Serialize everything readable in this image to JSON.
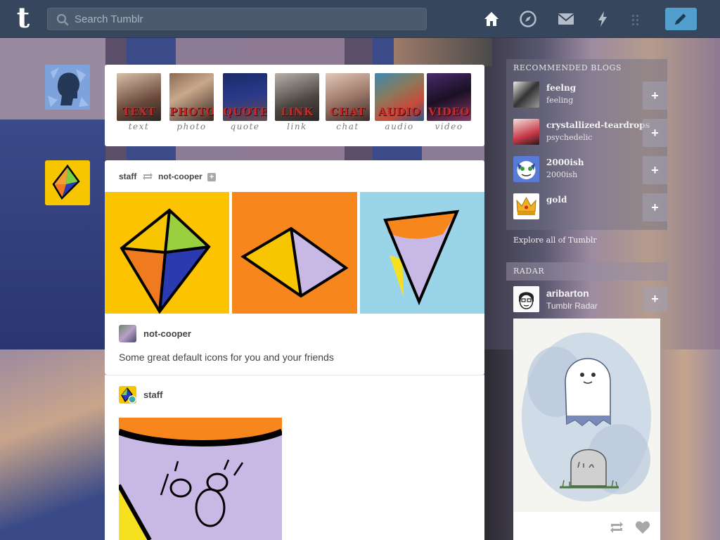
{
  "header": {
    "logo": "t",
    "search_placeholder": "Search Tumblr",
    "nav": [
      "home-icon",
      "explore-icon",
      "inbox-icon",
      "activity-icon",
      "account-icon"
    ],
    "compose_icon": "pencil-icon"
  },
  "post_types": [
    {
      "word": "TEXT",
      "label": "text"
    },
    {
      "word": "PHOTO",
      "label": "photo"
    },
    {
      "word": "QUOTE",
      "label": "quote"
    },
    {
      "word": "LINK",
      "label": "link"
    },
    {
      "word": "CHAT",
      "label": "chat"
    },
    {
      "word": "AUDIO",
      "label": "audio"
    },
    {
      "word": "VIDEO",
      "label": "video"
    }
  ],
  "post1": {
    "blog": "staff",
    "reblogged_from": "not-cooper",
    "source": "not-cooper",
    "caption": "Some great default icons for you and your friends"
  },
  "post2": {
    "blog": "staff"
  },
  "recommended": {
    "title": "RECOMMENDED BLOGS",
    "items": [
      {
        "name": "feelng",
        "sub": "feeling"
      },
      {
        "name": "crystallized-teardrops",
        "sub": "psychedelic"
      },
      {
        "name": "2000ish",
        "sub": "2000ish"
      },
      {
        "name": "gold",
        "sub": ""
      }
    ],
    "explore": "Explore all of Tumblr"
  },
  "radar": {
    "title": "RADAR",
    "name": "aribarton",
    "sub": "Tumblr Radar"
  },
  "colors": {
    "header_bg": "#36465d",
    "compose_bg": "#529ecc"
  }
}
